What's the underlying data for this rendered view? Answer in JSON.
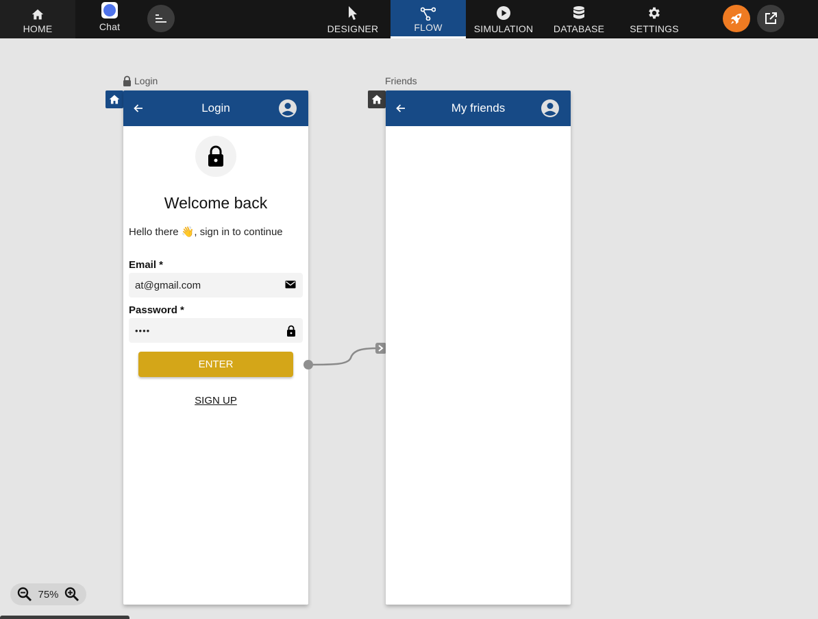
{
  "nav": {
    "home": "HOME",
    "chat": "Chat",
    "designer": "DESIGNER",
    "flow": "FLOW",
    "simulation": "SIMULATION",
    "database": "DATABASE",
    "settings": "SETTINGS",
    "active": "FLOW",
    "active_color": "#174a86",
    "launch_color": "#ef7b22"
  },
  "screens": {
    "login": {
      "label": "Login",
      "header_title": "Login",
      "welcome": "Welcome back",
      "hello": "Hello there 👋, sign in to continue",
      "email_label": "Email *",
      "email_value": "at@gmail.com",
      "password_label": "Password *",
      "password_value": "••••",
      "enter_button": "ENTER",
      "signup_link": "SIGN UP",
      "button_color": "#d4a618"
    },
    "friends": {
      "label": "Friends",
      "header_title": "My friends"
    }
  },
  "zoom": {
    "level": "75%"
  }
}
